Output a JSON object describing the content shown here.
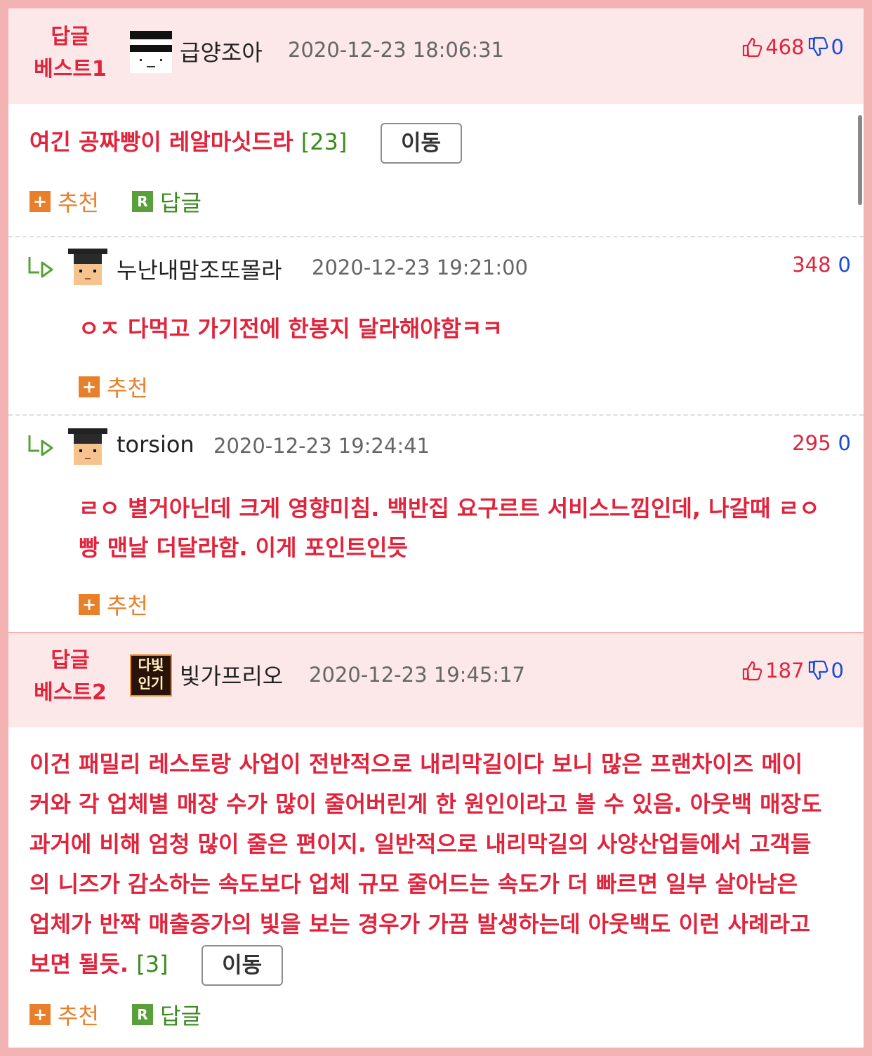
{
  "best1": {
    "label_line1": "답글",
    "label_line2": "베스트1",
    "nick": "급양조아",
    "date": "2020-12-23 18:06:31",
    "up": "468",
    "down": "0",
    "text": "여긴 공짜빵이 레알마싯드라",
    "reply_count": "[23]",
    "move_label": "이동",
    "recommend_label": "추천",
    "reply_label": "답글"
  },
  "replies": [
    {
      "nick": "누난내맘조또몰라",
      "date": "2020-12-23 19:21:00",
      "up": "348",
      "down": "0",
      "text": "ㅇㅈ 다먹고 가기전에 한봉지 달라해야함ㅋㅋ",
      "recommend_label": "추천"
    },
    {
      "nick": "torsion",
      "date": "2020-12-23 19:24:41",
      "up": "295",
      "down": "0",
      "text_line1": "ㄹㅇ 별거아닌데 크게 영향미침. 백반집 요구르트 서비스느낌인데, 나갈때 ㄹㅇ",
      "text_line2": "빵 맨날 더달라함. 이게 포인트인듯",
      "recommend_label": "추천"
    }
  ],
  "best2": {
    "label_line1": "답글",
    "label_line2": "베스트2",
    "nick": "빛가프리오",
    "avatar_text_top": "다빛",
    "avatar_text_bottom": "인기",
    "date": "2020-12-23 19:45:17",
    "up": "187",
    "down": "0",
    "text_lines": [
      "이건 패밀리 레스토랑 사업이 전반적으로 내리막길이다 보니 많은 프랜차이즈 메이",
      "커와 각 업체별 매장 수가 많이 줄어버린게 한 원인이라고 볼 수 있음. 아웃백 매장도",
      "과거에 비해 엄청 많이 줄은 편이지. 일반적으로 내리막길의 사양산업들에서 고객들",
      "의 니즈가 감소하는 속도보다 업체 규모 줄어드는 속도가 더 빠르면 일부 살아남은",
      "업체가 반짝 매출증가의 빛을 보는 경우가 가끔 발생하는데 아웃백도 이런 사례라고"
    ],
    "last_line": "보면 될듯.",
    "reply_count": "[3]",
    "move_label": "이동",
    "recommend_label": "추천",
    "reply_label": "답글"
  },
  "colors": {
    "accent_red": "#e0243c",
    "vote_blue": "#1a4bd8",
    "recommend_orange": "#e8802b",
    "reply_green": "#3a8a1e",
    "best_header_bg": "#fde8e9",
    "frame_border": "#f3b3b3"
  }
}
